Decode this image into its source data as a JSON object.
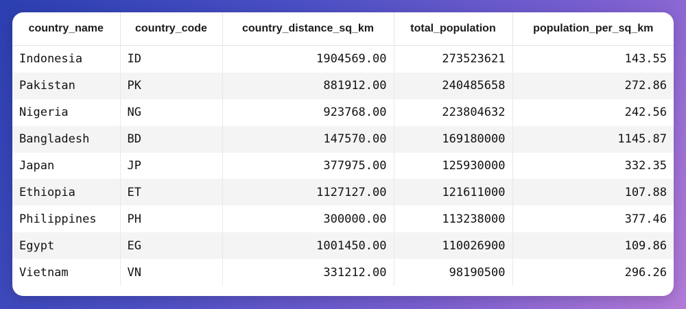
{
  "table": {
    "columns": [
      "country_name",
      "country_code",
      "country_distance_sq_km",
      "total_population",
      "population_per_sq_km"
    ],
    "rows": [
      [
        "Indonesia",
        "ID",
        "1904569.00",
        "273523621",
        "143.55"
      ],
      [
        "Pakistan",
        "PK",
        "881912.00",
        "240485658",
        "272.86"
      ],
      [
        "Nigeria",
        "NG",
        "923768.00",
        "223804632",
        "242.56"
      ],
      [
        "Bangladesh",
        "BD",
        "147570.00",
        "169180000",
        "1145.87"
      ],
      [
        "Japan",
        "JP",
        "377975.00",
        "125930000",
        "332.35"
      ],
      [
        "Ethiopia",
        "ET",
        "1127127.00",
        "121611000",
        "107.88"
      ],
      [
        "Philippines",
        "PH",
        "300000.00",
        "113238000",
        "377.46"
      ],
      [
        "Egypt",
        "EG",
        "1001450.00",
        "110026900",
        "109.86"
      ],
      [
        "Vietnam",
        "VN",
        "331212.00",
        "98190500",
        "296.26"
      ]
    ]
  }
}
